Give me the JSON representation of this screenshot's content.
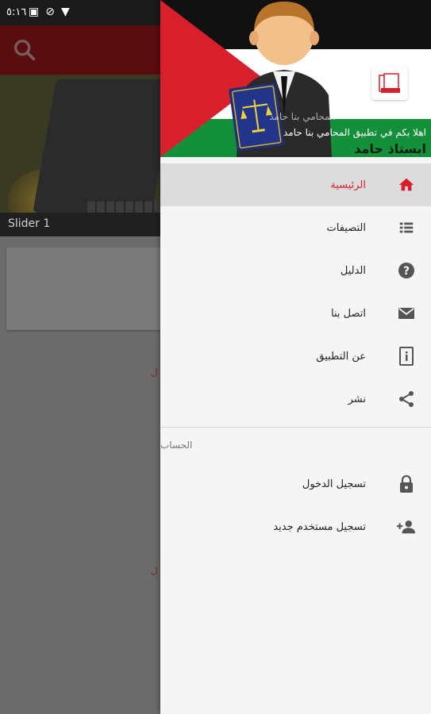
{
  "status": {
    "time": "٥:١٦"
  },
  "background": {
    "slider_caption": "Slider 1",
    "red_text_1": "ل",
    "red_text_2": "ل"
  },
  "drawer": {
    "header": {
      "faded_name": "المحامي بنا حامد",
      "welcome": "اهلا بكم في تطبيق المحامي بنا حامد",
      "big_title": "ابستاذ حامد"
    },
    "menu": [
      {
        "label": "الرئيسية",
        "icon": "home-icon",
        "active": true
      },
      {
        "label": "التصيفات",
        "icon": "list-icon"
      },
      {
        "label": "الدليل",
        "icon": "help-icon"
      },
      {
        "label": "اتصل بنا",
        "icon": "mail-icon"
      },
      {
        "label": "عن التطبيق",
        "icon": "info-icon"
      },
      {
        "label": "نشر",
        "icon": "share-icon"
      }
    ],
    "account_section": "الحساب",
    "account": [
      {
        "label": "تسجيل الدخول",
        "icon": "lock-icon"
      },
      {
        "label": "تسجيل مستخدم جديد",
        "icon": "add-user-icon"
      }
    ]
  },
  "colors": {
    "accent": "#d81f2c",
    "icon_gray": "#555555"
  }
}
